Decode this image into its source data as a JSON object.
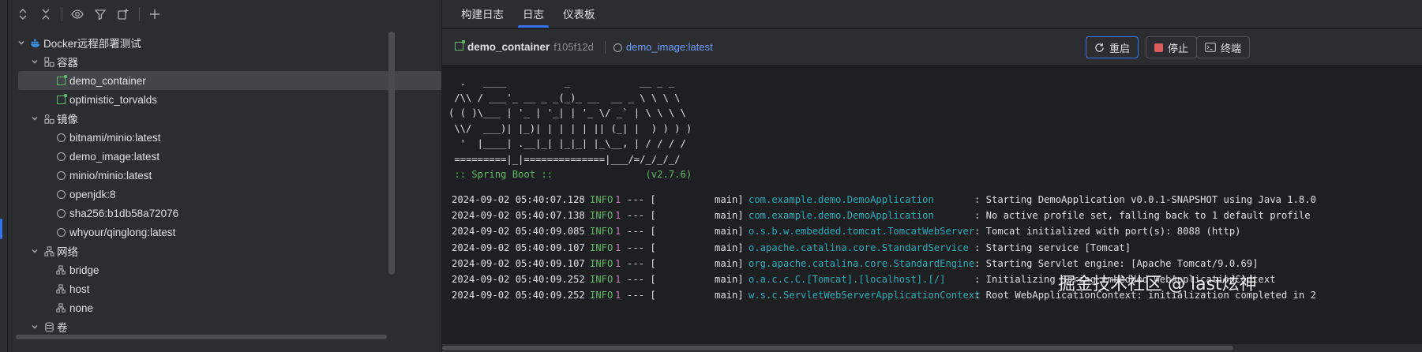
{
  "left_panel": {
    "toolbar": {
      "expand_all_icon": "expand-all-icon",
      "collapse_all_icon": "collapse-all-icon",
      "view_icon": "eye-icon",
      "filter_icon": "filter-icon",
      "new_group_icon": "new-group-icon",
      "add_icon": "plus-icon"
    },
    "tree": {
      "root_label": "Docker远程部署测试",
      "containers_label": "容器",
      "containers": [
        "demo_container",
        "optimistic_torvalds"
      ],
      "images_label": "镜像",
      "images": [
        "bitnami/minio:latest",
        "demo_image:latest",
        "minio/minio:latest",
        "openjdk:8",
        "sha256:b1db58a72076",
        "whyour/qinglong:latest"
      ],
      "networks_label": "网络",
      "networks": [
        "bridge",
        "host",
        "none"
      ],
      "volumes_label": "卷"
    }
  },
  "right_panel": {
    "tabs": [
      {
        "label": "构建日志"
      },
      {
        "label": "日志"
      },
      {
        "label": "仪表板"
      }
    ],
    "active_tab": "日志",
    "header": {
      "container_name": "demo_container",
      "container_id": "f105f12d",
      "image_name": "demo_image:latest"
    },
    "actions": {
      "restart_label": "重启",
      "stop_label": "停止",
      "terminal_label": "终端"
    },
    "console": {
      "banner": [
        "  .   ____          _            __ _ _",
        " /\\\\ / ___'_ __ _ _(_)_ __  __ _ \\ \\ \\ \\",
        "( ( )\\___ | '_ | '_| | '_ \\/ _` | \\ \\ \\ \\",
        " \\\\/  ___)| |_)| | | | | || (_| |  ) ) ) )",
        "  '  |____| .__|_| |_|_| |_\\__, | / / / /",
        " =========|_|==============|___/=/_/_/_/"
      ],
      "spring_line": " :: Spring Boot ::                (v2.7.6)",
      "logs": [
        {
          "ts": "2024-09-02 05:40:07.128",
          "level": "INFO",
          "pid": "1",
          "sep": "--- [",
          "thread": "main]",
          "logger": "com.example.demo.DemoApplication",
          "msg": ": Starting DemoApplication v0.0.1-SNAPSHOT using Java 1.8.0"
        },
        {
          "ts": "2024-09-02 05:40:07.138",
          "level": "INFO",
          "pid": "1",
          "sep": "--- [",
          "thread": "main]",
          "logger": "com.example.demo.DemoApplication",
          "msg": ": No active profile set, falling back to 1 default profile"
        },
        {
          "ts": "2024-09-02 05:40:09.085",
          "level": "INFO",
          "pid": "1",
          "sep": "--- [",
          "thread": "main]",
          "logger": "o.s.b.w.embedded.tomcat.TomcatWebServer",
          "msg": ": Tomcat initialized with port(s): 8088 (http)"
        },
        {
          "ts": "2024-09-02 05:40:09.107",
          "level": "INFO",
          "pid": "1",
          "sep": "--- [",
          "thread": "main]",
          "logger": "o.apache.catalina.core.StandardService",
          "msg": ": Starting service [Tomcat]"
        },
        {
          "ts": "2024-09-02 05:40:09.107",
          "level": "INFO",
          "pid": "1",
          "sep": "--- [",
          "thread": "main]",
          "logger": "org.apache.catalina.core.StandardEngine",
          "msg": ": Starting Servlet engine: [Apache Tomcat/9.0.69]"
        },
        {
          "ts": "2024-09-02 05:40:09.252",
          "level": "INFO",
          "pid": "1",
          "sep": "--- [",
          "thread": "main]",
          "logger": "o.a.c.c.C.[Tomcat].[localhost].[/]",
          "msg": ": Initializing Spring embedded WebApplicationContext"
        },
        {
          "ts": "2024-09-02 05:40:09.252",
          "level": "INFO",
          "pid": "1",
          "sep": "--- [",
          "thread": "main]",
          "logger": "w.s.c.ServletWebServerApplicationContext",
          "msg": ": Root WebApplicationContext: initialization completed in 2"
        }
      ]
    }
  },
  "watermark": "掘金技术社区 @ last炫神",
  "colors": {
    "accent": "#3574f0",
    "info": "#5fb865",
    "logger": "#2aacb8",
    "pid": "#c77dbb",
    "stop": "#db5c5c"
  }
}
